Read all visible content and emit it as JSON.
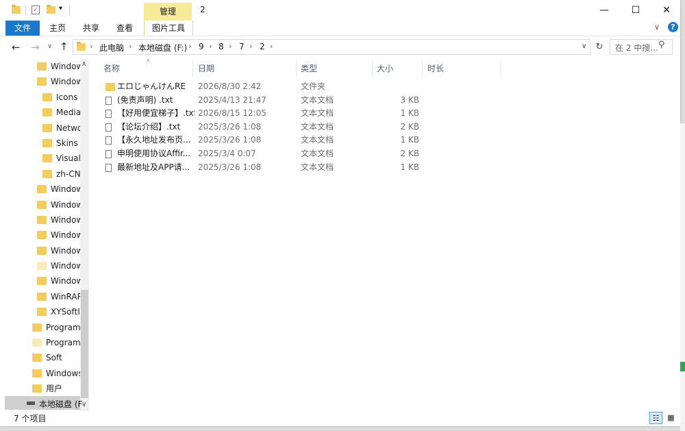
{
  "window": {
    "title": "2",
    "context_tab": "管理",
    "controls": {
      "minimize": "—",
      "maximize": "☐",
      "close": "✕"
    }
  },
  "ribbon": {
    "tabs": [
      "文件",
      "主页",
      "共享",
      "查看",
      "图片工具"
    ],
    "help": "?",
    "collapse": "∨"
  },
  "addressbar": {
    "crumbs": [
      "此电脑",
      "本地磁盘 (F:)",
      "9",
      "8",
      "7",
      "2"
    ],
    "separator": "›",
    "search_placeholder": "在 2 中搜...",
    "dropdown": "∨",
    "refresh": "↻"
  },
  "nav": {
    "back": "←",
    "forward": "→",
    "recent": "∨",
    "up": "↑",
    "items": [
      {
        "label": "Windows",
        "indent": 1
      },
      {
        "label": "Windows",
        "indent": 1
      },
      {
        "label": "Icons",
        "indent": 2
      },
      {
        "label": "Media",
        "indent": 2
      },
      {
        "label": "Netwo",
        "indent": 2
      },
      {
        "label": "Skins",
        "indent": 2
      },
      {
        "label": "Visuali",
        "indent": 2
      },
      {
        "label": "zh-CN",
        "indent": 2
      },
      {
        "label": "Windows",
        "indent": 1
      },
      {
        "label": "Windows",
        "indent": 1
      },
      {
        "label": "Windows",
        "indent": 1
      },
      {
        "label": "Windows",
        "indent": 1
      },
      {
        "label": "Windows",
        "indent": 1
      },
      {
        "label": "Windows",
        "indent": 1,
        "light": true
      },
      {
        "label": "Windows",
        "indent": 1
      },
      {
        "label": "WinRAR",
        "indent": 1
      },
      {
        "label": "XYSoftIr",
        "indent": 1
      },
      {
        "label": "Program",
        "indent": 0
      },
      {
        "label": "ProgramD",
        "indent": 0,
        "light": true
      },
      {
        "label": "Soft",
        "indent": 0
      },
      {
        "label": "Windows",
        "indent": 0
      },
      {
        "label": "用户",
        "indent": 0
      }
    ],
    "drive": "本地磁盘 (F",
    "scroll_up": "∧",
    "scroll_down": "∨"
  },
  "filelist": {
    "sort_arrow": "∧",
    "columns": [
      "名称",
      "日期",
      "类型",
      "大小",
      "时长"
    ],
    "rows": [
      {
        "name": "エロじゃんけんRE",
        "date": "2026/8/30 2:42",
        "type": "文件夹",
        "size": "",
        "folder": true
      },
      {
        "name": "(免责声明) .txt",
        "date": "2025/4/13 21:47",
        "type": "文本文档",
        "size": "3 KB"
      },
      {
        "name": "【好用便宜梯子】.txt",
        "date": "2026/8/15 12:05",
        "type": "文本文档",
        "size": "1 KB"
      },
      {
        "name": "【论坛介绍】.txt",
        "date": "2025/3/26 1:08",
        "type": "文本文档",
        "size": "2 KB"
      },
      {
        "name": "【永久地址发布页...",
        "date": "2025/3/26 1:08",
        "type": "文本文档",
        "size": "1 KB"
      },
      {
        "name": "申明使用协议Affir...",
        "date": "2025/3/4 0:07",
        "type": "文本文档",
        "size": "2 KB"
      },
      {
        "name": "最新地址及APP请...",
        "date": "2025/3/26 1:08",
        "type": "文本文档",
        "size": "1 KB"
      }
    ]
  },
  "statusbar": {
    "count": "7 个项目"
  },
  "colors": {
    "accent": "#1979ca",
    "context_tab": "#f7eb9a",
    "folder": "#f4cc5c"
  }
}
